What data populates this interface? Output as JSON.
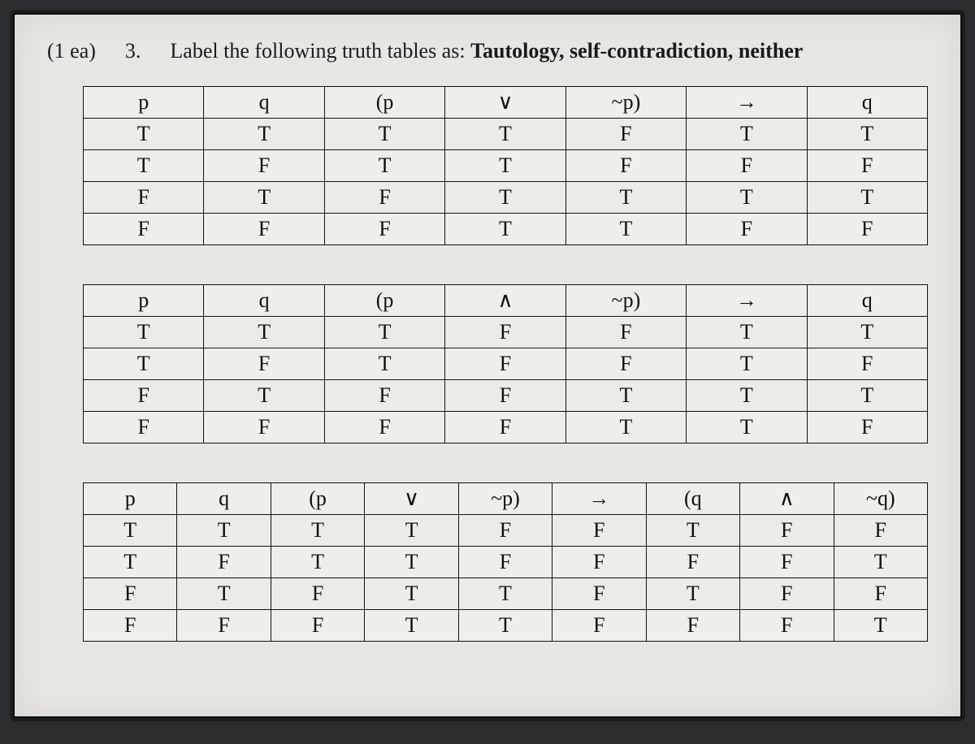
{
  "heading": {
    "points": "(1 ea)",
    "number": "3.",
    "instruction_prefix": "Label the following truth tables as: ",
    "instruction_bold": "Tautology, self-contradiction, neither"
  },
  "tables": [
    {
      "header": [
        "p",
        "q",
        "(p",
        "∨",
        "~p)",
        "→",
        "q"
      ],
      "rows": [
        [
          "T",
          "T",
          "T",
          "T",
          "F",
          "T",
          "T"
        ],
        [
          "T",
          "F",
          "T",
          "T",
          "F",
          "F",
          "F"
        ],
        [
          "F",
          "T",
          "F",
          "T",
          "T",
          "T",
          "T"
        ],
        [
          "F",
          "F",
          "F",
          "T",
          "T",
          "F",
          "F"
        ]
      ]
    },
    {
      "header": [
        "p",
        "q",
        "(p",
        "∧",
        "~p)",
        "→",
        "q"
      ],
      "rows": [
        [
          "T",
          "T",
          "T",
          "F",
          "F",
          "T",
          "T"
        ],
        [
          "T",
          "F",
          "T",
          "F",
          "F",
          "T",
          "F"
        ],
        [
          "F",
          "T",
          "F",
          "F",
          "T",
          "T",
          "T"
        ],
        [
          "F",
          "F",
          "F",
          "F",
          "T",
          "T",
          "F"
        ]
      ]
    },
    {
      "header": [
        "p",
        "q",
        "(p",
        "∨",
        "~p)",
        "→",
        "(q",
        "∧",
        "~q)"
      ],
      "rows": [
        [
          "T",
          "T",
          "T",
          "T",
          "F",
          "F",
          "T",
          "F",
          "F"
        ],
        [
          "T",
          "F",
          "T",
          "T",
          "F",
          "F",
          "F",
          "F",
          "T"
        ],
        [
          "F",
          "T",
          "F",
          "T",
          "T",
          "F",
          "T",
          "F",
          "F"
        ],
        [
          "F",
          "F",
          "F",
          "T",
          "T",
          "F",
          "F",
          "F",
          "T"
        ]
      ]
    }
  ]
}
